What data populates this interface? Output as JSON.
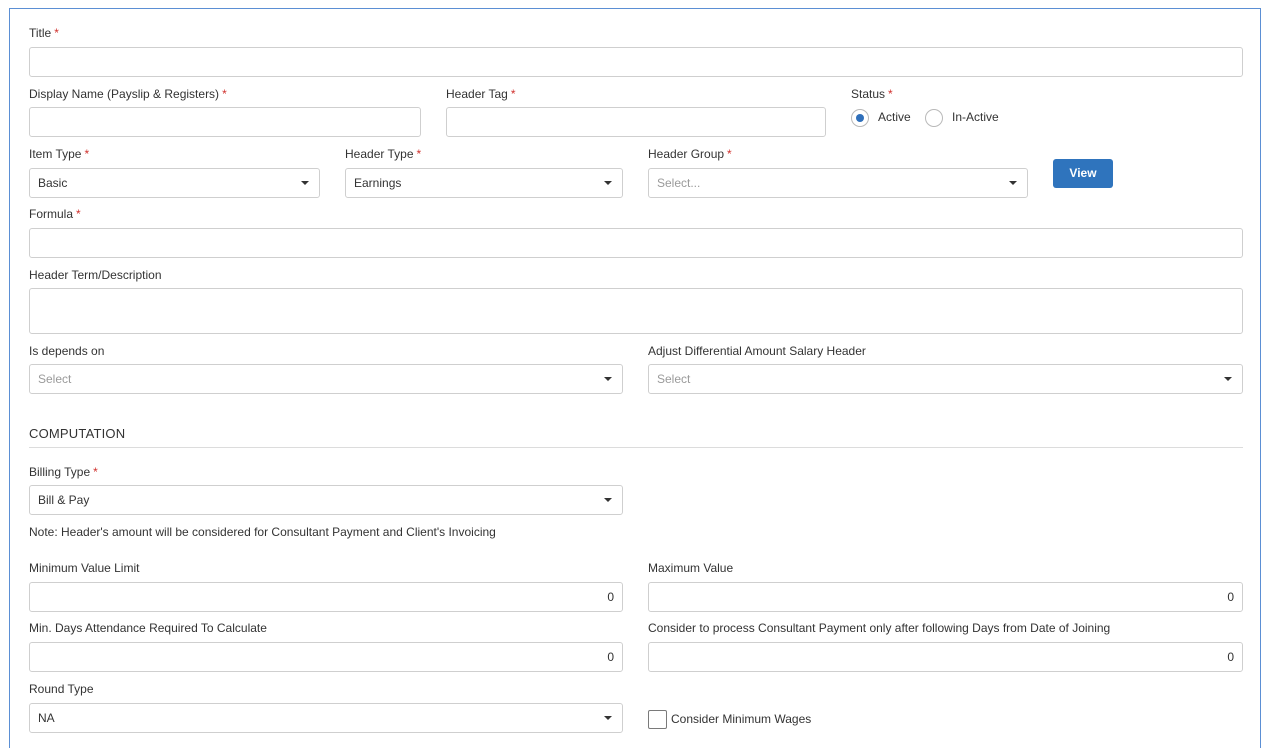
{
  "form": {
    "title": {
      "label": "Title",
      "required": "*",
      "value": ""
    },
    "display_name": {
      "label": "Display Name (Payslip & Registers)",
      "required": "*",
      "value": ""
    },
    "header_tag": {
      "label": "Header Tag",
      "required": "*",
      "value": ""
    },
    "status": {
      "label": "Status",
      "required": "*",
      "options": [
        {
          "label": "Active",
          "selected": true
        },
        {
          "label": "In-Active",
          "selected": false
        }
      ]
    },
    "item_type": {
      "label": "Item Type",
      "required": "*",
      "value": "Basic"
    },
    "header_type": {
      "label": "Header Type",
      "required": "*",
      "value": "Earnings"
    },
    "header_group": {
      "label": "Header Group",
      "required": "*",
      "placeholder": "Select..."
    },
    "view_button": "View",
    "formula": {
      "label": "Formula",
      "required": "*",
      "value": ""
    },
    "header_term": {
      "label": "Header Term/Description",
      "value": ""
    },
    "depends_on": {
      "label": "Is depends on",
      "placeholder": "Select"
    },
    "adjust_diff": {
      "label": "Adjust Differential Amount Salary Header",
      "placeholder": "Select"
    }
  },
  "computation": {
    "section_title": "COMPUTATION",
    "billing_type": {
      "label": "Billing Type",
      "required": "*",
      "value": "Bill & Pay"
    },
    "note": "Note: Header's amount will be considered for Consultant Payment and Client's Invoicing",
    "min_value": {
      "label": "Minimum Value Limit",
      "value": "0"
    },
    "max_value": {
      "label": "Maximum Value",
      "value": "0"
    },
    "min_days": {
      "label": "Min. Days Attendance Required To Calculate",
      "value": "0"
    },
    "consider_days": {
      "label": "Consider to process Consultant Payment only after following Days from Date of Joining",
      "value": "0"
    },
    "round_type": {
      "label": "Round Type",
      "value": "NA"
    },
    "min_wages": {
      "label": "Consider Minimum Wages",
      "checked": false
    }
  },
  "colors": {
    "accent": "#2f74bd",
    "required": "#d0312d",
    "panel_border": "#5b8fd4"
  }
}
